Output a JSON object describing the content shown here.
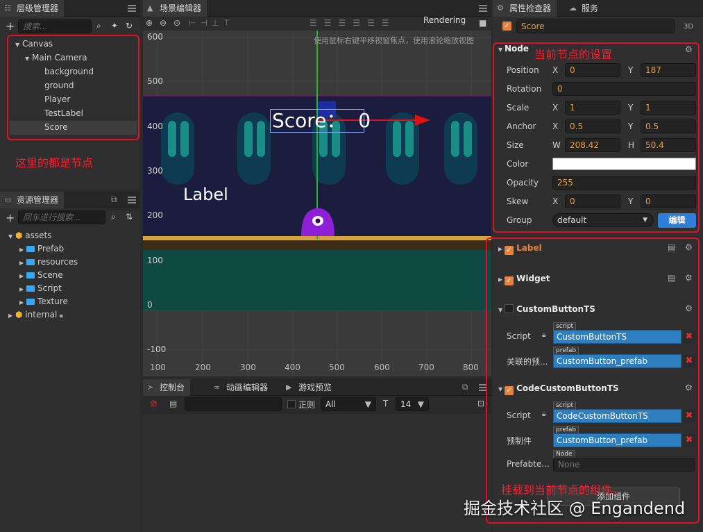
{
  "hierarchy_panel": {
    "tab": "层级管理器",
    "search_placeholder": "搜索...",
    "items": [
      "Canvas",
      "Main Camera",
      "background",
      "ground",
      "Player",
      "TestLabel",
      "Score"
    ],
    "annotation": "这里的都是节点"
  },
  "assets_panel": {
    "tab": "资源管理器",
    "search_placeholder": "回车进行搜索...",
    "items": [
      "assets",
      "Prefab",
      "resources",
      "Scene",
      "Script",
      "Texture",
      "internal"
    ]
  },
  "scene_panel": {
    "tab": "场景编辑器",
    "rendering": "Rendering",
    "hint": "使用鼠标右键平移视窗焦点，使用滚轮缩放视图",
    "ruler_y": [
      "600",
      "500",
      "400",
      "300",
      "200",
      "100",
      "0",
      "-100"
    ],
    "ruler_x": [
      "100",
      "200",
      "300",
      "400",
      "500",
      "600",
      "700",
      "800"
    ],
    "score_text": "Score：  0",
    "label_text": "Label"
  },
  "console_panel": {
    "tabs": [
      "控制台",
      "动画编辑器",
      "游戏预览"
    ],
    "regex_label": "正则",
    "filter_value": "All",
    "font_size": "14"
  },
  "inspector": {
    "tabs": [
      "属性检查器",
      "服务"
    ],
    "node_name": "Score",
    "mode_3d": "3D",
    "node_section": "Node",
    "node_annotation": "当前节点的设置",
    "labels": {
      "position": "Position",
      "rotation": "Rotation",
      "scale": "Scale",
      "anchor": "Anchor",
      "size": "Size",
      "color": "Color",
      "opacity": "Opacity",
      "skew": "Skew",
      "group": "Group"
    },
    "axes": {
      "x": "X",
      "y": "Y",
      "w": "W",
      "h": "H"
    },
    "values": {
      "pos_x": "0",
      "pos_y": "187",
      "rotation": "0",
      "scale_x": "1",
      "scale_y": "1",
      "anchor_x": "0.5",
      "anchor_y": "0.5",
      "size_w": "208.42",
      "size_h": "50.4",
      "opacity": "255",
      "skew_x": "0",
      "skew_y": "0",
      "group": "default"
    },
    "edit_button": "编辑",
    "components": {
      "label": "Label",
      "widget": "Widget",
      "custom_ts": "CustomButtonTS",
      "code_custom_ts": "CodeCustomButtonTS"
    },
    "custom_fields": {
      "script_label": "Script",
      "script_tag": "script",
      "script_value": "CustomButtonTS",
      "prefab_label": "关联的预...",
      "prefab_tag": "prefab",
      "prefab_value": "CustomButton_prefab"
    },
    "code_fields": {
      "script_label": "Script",
      "script_tag": "script",
      "script_value": "CodeCustomButtonTS",
      "prefab_label": "预制件",
      "prefab_tag": "prefab",
      "prefab_value": "CustomButton_prefab",
      "prefabte_label": "Prefabte...",
      "node_tag": "Node",
      "node_value": "None"
    },
    "add_component": "添加组件",
    "component_annotation": "挂载到当前节点的组件。"
  },
  "watermark": "掘金技术社区 @ Engandend",
  "colors": {
    "accent": "#e8823c",
    "annotation": "#ff1a2e",
    "asset_blue": "#2e7fc0"
  }
}
